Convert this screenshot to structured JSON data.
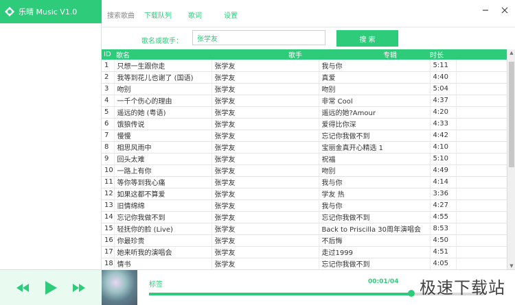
{
  "app": {
    "title": "乐晴 Music V1.0",
    "accent": "#2ecc7a"
  },
  "tabs": [
    {
      "label": "搜索歌曲",
      "active": true
    },
    {
      "label": "下载队列",
      "active": false
    },
    {
      "label": "歌词",
      "active": false
    },
    {
      "label": "设置",
      "active": false
    }
  ],
  "window": {
    "minimize_icon": "minimize-icon",
    "close_icon": "close-icon"
  },
  "search": {
    "label": "歌名或歌手：",
    "value": "张学友",
    "button": "搜 索"
  },
  "table": {
    "headers": [
      "ID",
      "歌名",
      "歌手",
      "专辑",
      "时长"
    ],
    "rows": [
      [
        "1",
        "只想一生跟你走",
        "张学友",
        "我与你",
        "5:11"
      ],
      [
        "2",
        "我等到花儿也谢了 (国语)",
        "张学友",
        "真爱",
        "4:40"
      ],
      [
        "3",
        "吻别",
        "张学友",
        "吻别",
        "5:04"
      ],
      [
        "4",
        "一千个伤心的理由",
        "张学友",
        "非常 Cool",
        "4:37"
      ],
      [
        "5",
        "遥远的她 (粤语)",
        "张学友",
        "遥远的她?Amour",
        "4:20"
      ],
      [
        "6",
        "饿狼传说",
        "张学友",
        "爱得比你深",
        "4:33"
      ],
      [
        "7",
        "慢慢",
        "张学友",
        "忘记你我做不到",
        "4:42"
      ],
      [
        "8",
        "相思风雨中",
        "张学友",
        "宝丽金真开心精选 1",
        "4:10"
      ],
      [
        "9",
        "回头太难",
        "张学友",
        "祝福",
        "5:10"
      ],
      [
        "10",
        "一路上有你",
        "张学友",
        "吻别",
        "4:49"
      ],
      [
        "11",
        "等你等到我心痛",
        "张学友",
        "我与你",
        "4:14"
      ],
      [
        "12",
        "如果这都不算爱",
        "张学友",
        "学友 热",
        "3:36"
      ],
      [
        "13",
        "旧情绵绵",
        "张学友",
        "我与你",
        "4:27"
      ],
      [
        "14",
        "忘记你我做不到",
        "张学友",
        "忘记你我做不到",
        "4:55"
      ],
      [
        "15",
        "轻抚你的脸 (Live)",
        "张学友",
        "Back to Priscilla 30周年演唱会",
        "8:53"
      ],
      [
        "16",
        "你最珍贵",
        "张学友",
        "不后悔",
        "4:50"
      ],
      [
        "17",
        "她来听我的演唱会",
        "张学友",
        "走过1999",
        "4:51"
      ],
      [
        "18",
        "情书",
        "张学友",
        "忘记你我做不到",
        "4:05"
      ]
    ]
  },
  "player": {
    "track_label": "标签",
    "time": "00:01/04",
    "progress": 0.78,
    "icons": [
      "previous-icon",
      "play-icon",
      "next-icon"
    ]
  },
  "watermark": "极速下载站"
}
